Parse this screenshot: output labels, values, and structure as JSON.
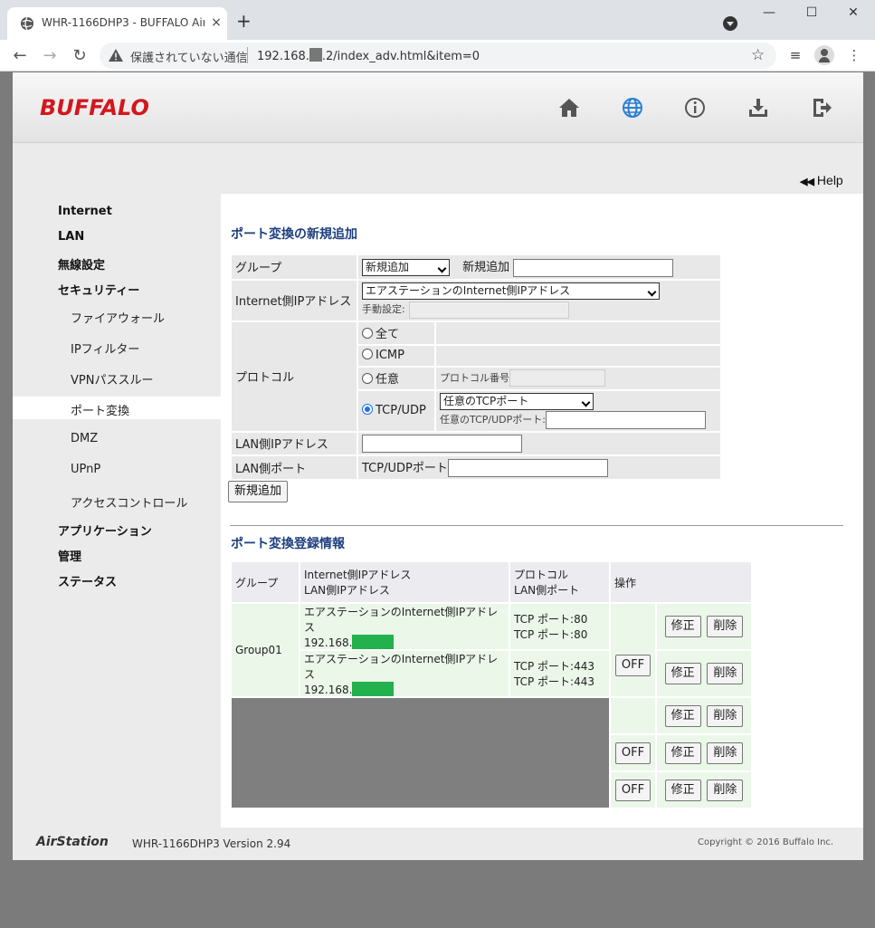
{
  "browser": {
    "tab_title": "WHR-1166DHP3 - BUFFALO AirSt",
    "tab_close": "×",
    "new_tab": "+",
    "win_minimize": "—",
    "win_maximize": "☐",
    "win_close": "✕",
    "security_text": "保護されていない通信",
    "url_prefix": "192.168.",
    "url_suffix": ".2/index_adv.html&item=0"
  },
  "header": {
    "logo": "BUFFALO",
    "icons": [
      "home-icon",
      "globe-icon",
      "info-icon",
      "download-icon",
      "logout-icon"
    ]
  },
  "help": {
    "label": "Help",
    "arrows": "◀◀"
  },
  "sidebar": {
    "items": [
      {
        "label": "Internet"
      },
      {
        "label": "LAN"
      },
      {
        "label": "無線設定"
      },
      {
        "label": "セキュリティー"
      },
      {
        "label": "ファイアウォール"
      },
      {
        "label": "IPフィルター"
      },
      {
        "label": "VPNパススルー"
      },
      {
        "label": "ポート変換"
      },
      {
        "label": "DMZ"
      },
      {
        "label": "UPnP"
      },
      {
        "label": "アクセスコントロール"
      },
      {
        "label": "アプリケーション"
      },
      {
        "label": "管理"
      },
      {
        "label": "ステータス"
      }
    ]
  },
  "add_form": {
    "title": "ポート変換の新規追加",
    "group_label": "グループ",
    "group_select": "新規追加",
    "group_new_label": "新規追加",
    "internet_ip_label": "Internet側IPアドレス",
    "internet_ip_select": "エアステーションのInternet側IPアドレス",
    "manual_label": "手動設定:",
    "protocol_label": "プロトコル",
    "proto_all": "全て",
    "proto_icmp": "ICMP",
    "proto_any": "任意",
    "proto_number_label": "プロトコル番号",
    "proto_tcpudp": "TCP/UDP",
    "tcp_port_select": "任意のTCPポート",
    "any_port_label": "任意のTCP/UDPポート:",
    "lan_ip_label": "LAN側IPアドレス",
    "lan_port_label": "LAN側ポート",
    "lan_port_sub": "TCP/UDPポート",
    "add_button": "新規追加"
  },
  "registered": {
    "title": "ポート変換登録情報",
    "col_group": "グループ",
    "col_ip_1": "Internet側IPアドレス",
    "col_ip_2": "LAN側IPアドレス",
    "col_proto_1": "プロトコル",
    "col_proto_2": "LAN側ポート",
    "col_ops": "操作",
    "group_name": "Group01",
    "rows": [
      {
        "inet": "エアステーションのInternet側IPアドレス",
        "lan": "192.168.",
        "p1": "TCP ポート:80",
        "p2": "TCP ポート:80"
      },
      {
        "inet": "エアステーションのInternet側IPアドレス",
        "lan": "192.168.",
        "p1": "TCP ポート:443",
        "p2": "TCP ポート:443"
      }
    ],
    "off_label": "OFF",
    "edit_label": "修正",
    "delete_label": "削除"
  },
  "footer": {
    "logo": "AirStation",
    "version": "WHR-1166DHP3 Version 2.94",
    "copyright": "Copyright © 2016 Buffalo Inc."
  }
}
